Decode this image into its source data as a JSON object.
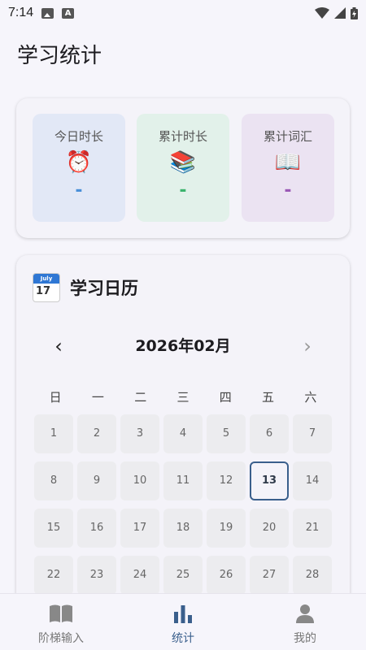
{
  "status_bar": {
    "time": "7:14"
  },
  "page_title": "学习统计",
  "stats": [
    {
      "label": "今日时长",
      "emoji": "⏰",
      "value": "-",
      "value_color": "#4a90d9"
    },
    {
      "label": "累计时长",
      "emoji": "📚",
      "value": "-",
      "value_color": "#3cb46e"
    },
    {
      "label": "累计词汇",
      "emoji": "📖",
      "value": "-",
      "value_color": "#9b59b6"
    }
  ],
  "calendar": {
    "icon_month": "July",
    "icon_day": "17",
    "title": "学习日历",
    "prev_icon": "chevron-left-icon",
    "next_icon": "chevron-right-icon",
    "month_label": "2026年02月",
    "weekdays": [
      "日",
      "一",
      "二",
      "三",
      "四",
      "五",
      "六"
    ],
    "days": [
      "1",
      "2",
      "3",
      "4",
      "5",
      "6",
      "7",
      "8",
      "9",
      "10",
      "11",
      "12",
      "13",
      "14",
      "15",
      "16",
      "17",
      "18",
      "19",
      "20",
      "21",
      "22",
      "23",
      "24",
      "25",
      "26",
      "27",
      "28"
    ],
    "today": "13"
  },
  "bottom_nav": {
    "items": [
      {
        "label": "阶梯输入",
        "icon": "book-icon",
        "active": false
      },
      {
        "label": "统计",
        "icon": "bar-chart-icon",
        "active": true
      },
      {
        "label": "我的",
        "icon": "person-icon",
        "active": false
      }
    ]
  },
  "colors": {
    "accent": "#3a5f8c",
    "background": "#f6f5fb"
  }
}
